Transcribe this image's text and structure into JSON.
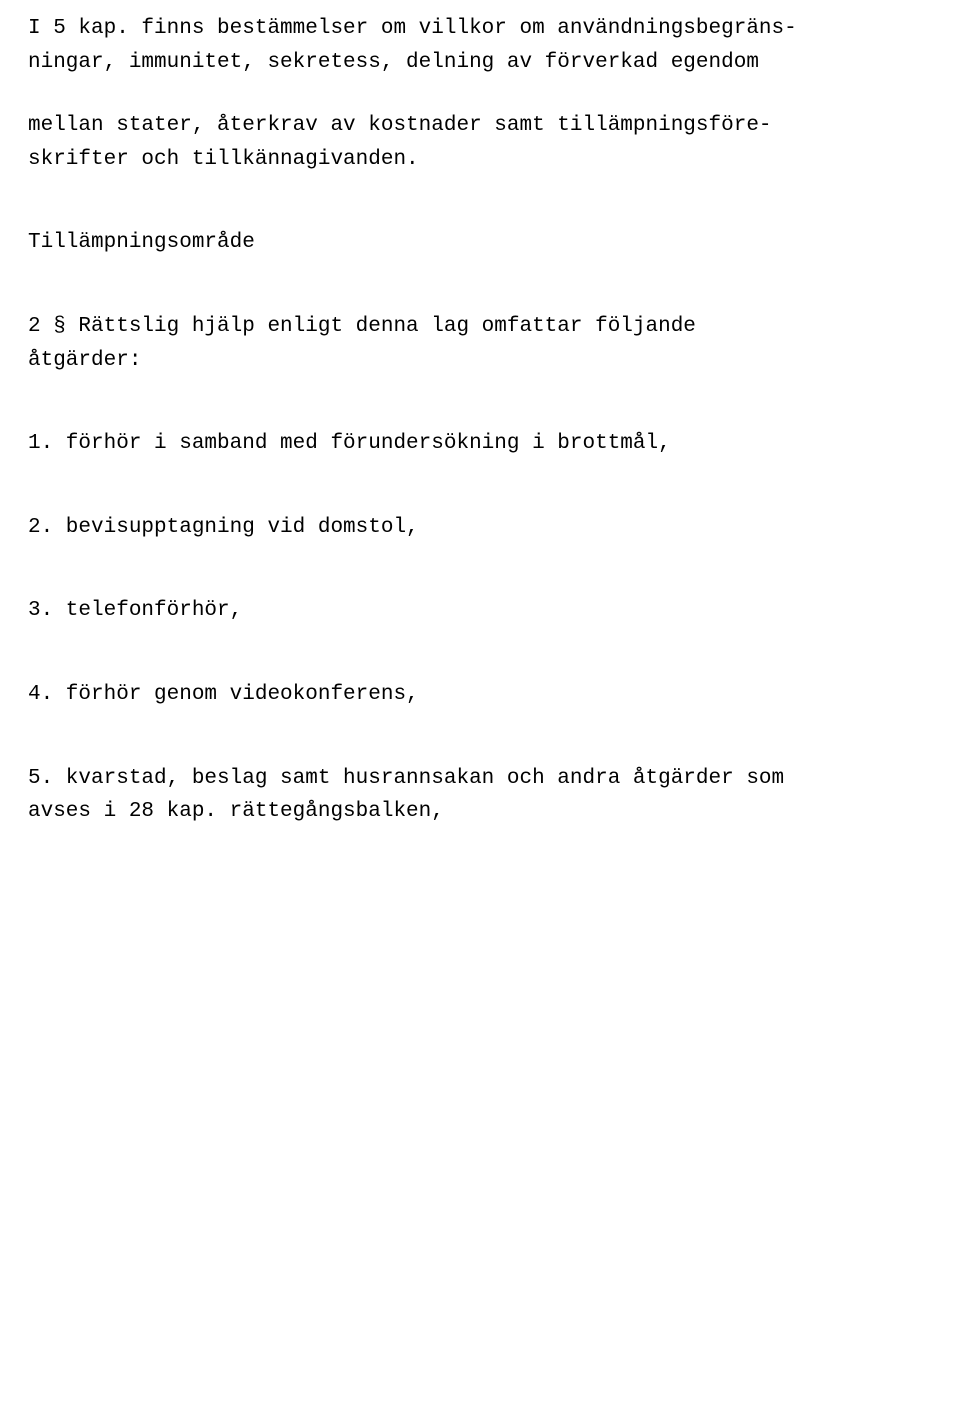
{
  "para1_line1": "I 5 kap. finns bestämmelser om villkor om användningsbegräns-",
  "para1_line2": "ningar, immunitet, sekretess, delning av förverkad egendom",
  "para2_line1": "mellan stater, återkrav av kostnader samt tillämpningsföre-",
  "para2_line2": "skrifter och tillkännagivanden.",
  "heading": "Tillämpningsområde",
  "section2_line1": "2 § Rättslig hjälp enligt denna lag omfattar följande",
  "section2_line2": "åtgärder:",
  "item1": "1. förhör i samband med förundersökning i brottmål,",
  "item2": "2. bevisupptagning vid domstol,",
  "item3": "3. telefonförhör,",
  "item4": "4. förhör genom videokonferens,",
  "item5_line1": "5. kvarstad, beslag samt husrannsakan och andra åtgärder som",
  "item5_line2": "avses i 28 kap. rättegångsbalken,"
}
